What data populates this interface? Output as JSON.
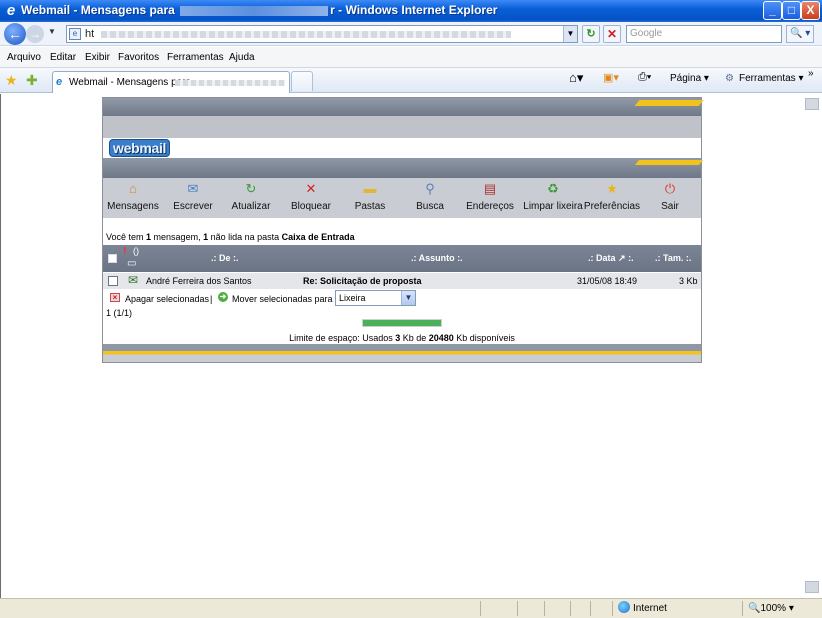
{
  "window": {
    "title_prefix": "Webmail - Mensagens para",
    "title_suffix": "r - Windows Internet Explorer",
    "minimize": "_",
    "maximize": "□",
    "close": "X"
  },
  "address": {
    "url_prefix": "ht"
  },
  "search": {
    "placeholder": "Google",
    "button": "🔍 ▾"
  },
  "menu": {
    "arquivo": "Arquivo",
    "editar": "Editar",
    "exibir": "Exibir",
    "favoritos": "Favoritos",
    "ferramentas": "Ferramentas",
    "ajuda": "Ajuda"
  },
  "tabs": [
    {
      "label": "Webmail - Mensagens para"
    }
  ],
  "commands": {
    "pagina": "Página",
    "ferramentas": "Ferramentas",
    "more": "»"
  },
  "webmail": {
    "logo": "webmail",
    "toolbar": [
      {
        "label": "Mensagens",
        "icon": "⌂",
        "color": "#d9832b"
      },
      {
        "label": "Escrever",
        "icon": "✉",
        "color": "#4b7fc4"
      },
      {
        "label": "Atualizar",
        "icon": "↻",
        "color": "#3a9a3a"
      },
      {
        "label": "Bloquear",
        "icon": "✕",
        "color": "#d02020"
      },
      {
        "label": "Pastas",
        "icon": "▬",
        "color": "#e6b534"
      },
      {
        "label": "Busca",
        "icon": "⚲",
        "color": "#5a7fb8"
      },
      {
        "label": "Endereços",
        "icon": "▤",
        "color": "#b03030"
      },
      {
        "label": "Limpar lixeira",
        "icon": "♻",
        "color": "#3a9a3a"
      },
      {
        "label": "Preferências",
        "icon": "★",
        "color": "#e8b51a"
      },
      {
        "label": "Sair",
        "icon": "⏻",
        "color": "#e03020"
      }
    ],
    "info": {
      "t1": "Você tem ",
      "count": "1",
      "t2": " mensagem, ",
      "unread": "1",
      "t3": " não lida na pasta ",
      "folder": "Caixa de Entrada"
    },
    "columns": {
      "from": ".: De :.",
      "subject": ".: Assunto :.",
      "date": ".: Data",
      "sort": "↗ :.",
      "size": ".: Tam. :."
    },
    "header_marks": {
      "priority": "!",
      "attachment": "()",
      "envelope": "▭"
    },
    "messages": [
      {
        "from": "André Ferreira dos Santos",
        "subject": "Re: Solicitação de proposta",
        "date": "31/05/08 18:49",
        "size": "3 Kb"
      }
    ],
    "actions": {
      "delete": "Apagar selecionadas",
      "separator": "|",
      "move": "Mover selecionadas para",
      "move_target": "Lixeira",
      "move_options": [
        "Lixeira"
      ]
    },
    "pager": "1 (1/1)",
    "quota": {
      "t1": "Limite de espaço: Usados ",
      "used": "3",
      "t2": " Kb de ",
      "total": "20480",
      "t3": " Kb disponíveis",
      "bar_fraction": 1.0
    }
  },
  "status": {
    "zone": "Internet",
    "zoom": "🔍100%",
    "zoom_drop": "▾"
  }
}
